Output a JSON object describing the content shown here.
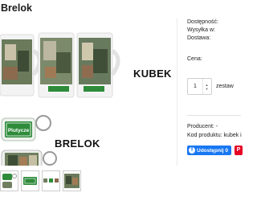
{
  "product": {
    "title": "Brelok",
    "image": {
      "mug_label": "KUBEK",
      "keychain_label": "BRELOK",
      "sign_text": "Plutycze"
    },
    "thumbnails": [
      "thumb-keychain",
      "thumb-sign",
      "thumb-strip",
      "thumb-mug"
    ]
  },
  "details": {
    "availability_label": "Dostępność:",
    "shipping_label": "Wysyłka w:",
    "delivery_label": "Dostawa:",
    "price_label": "Cena:",
    "quantity_value": "1",
    "quantity_unit": "zestaw",
    "producer_label": "Producent:",
    "producer_value": "-",
    "code_label": "Kod produktu:",
    "code_value": "kubek i"
  },
  "share": {
    "facebook_label": "Udostępnij 0",
    "facebook_icon": "f",
    "pinterest_icon": "P"
  },
  "colors": {
    "facebook": "#1877f2",
    "pinterest": "#e60023",
    "sign_green": "#2e8b3a"
  }
}
